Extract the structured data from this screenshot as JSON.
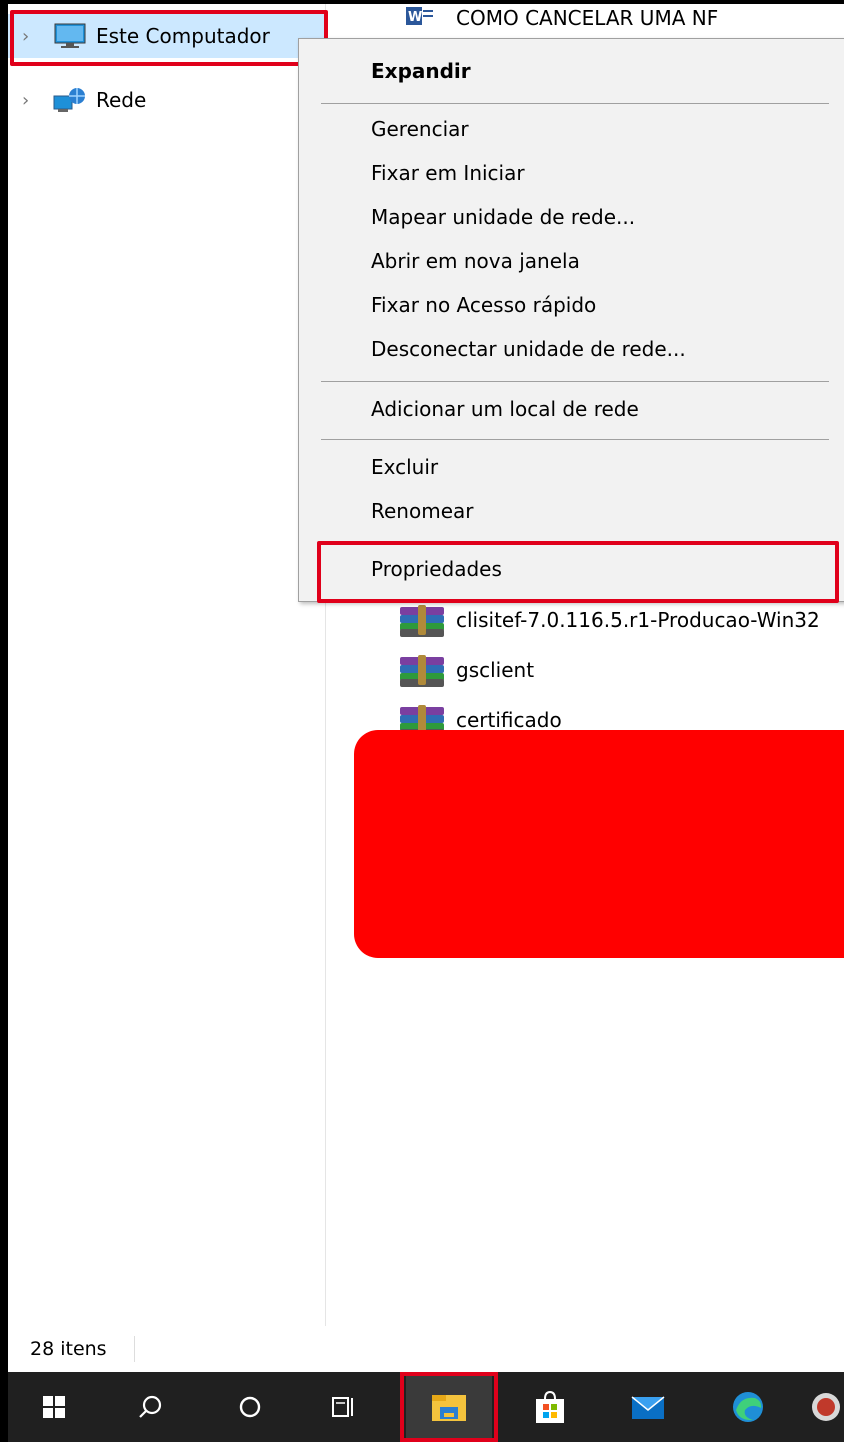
{
  "nav": {
    "items": [
      {
        "label": "Este Computador",
        "icon": "computer-icon",
        "selected": true
      },
      {
        "label": "Rede",
        "icon": "network-icon",
        "selected": false
      }
    ]
  },
  "files": [
    {
      "name": "COMO CANCELAR UMA NF",
      "icon": "word-doc-icon"
    },
    {
      "name": "clisitef-7.0.116.5.r1-Producao-Win32",
      "icon": "winrar-archive-icon"
    },
    {
      "name": "gsclient",
      "icon": "winrar-archive-icon"
    },
    {
      "name": "certificado",
      "icon": "winrar-archive-icon"
    }
  ],
  "context_menu": {
    "items": [
      {
        "label": "Expandir",
        "bold": true
      },
      {
        "label": "Gerenciar"
      },
      {
        "label": "Fixar em Iniciar"
      },
      {
        "label": "Mapear unidade de rede..."
      },
      {
        "label": "Abrir em nova janela"
      },
      {
        "label": "Fixar no Acesso rápido"
      },
      {
        "label": "Desconectar unidade de rede..."
      },
      {
        "label": "Adicionar um local de rede"
      },
      {
        "label": "Excluir"
      },
      {
        "label": "Renomear"
      },
      {
        "label": "Propriedades"
      }
    ]
  },
  "status": {
    "item_count": "28 itens"
  },
  "taskbar": {
    "buttons": [
      "windows-start-icon",
      "search-icon",
      "cortana-icon",
      "task-view-icon",
      "file-explorer-icon",
      "microsoft-store-icon",
      "mail-icon",
      "edge-icon",
      "app-icon"
    ],
    "active": "file-explorer-icon"
  },
  "colors": {
    "highlight": "#e0001b",
    "selection": "#cce8ff",
    "taskbar": "#202020",
    "redaction": "#ff0000"
  }
}
